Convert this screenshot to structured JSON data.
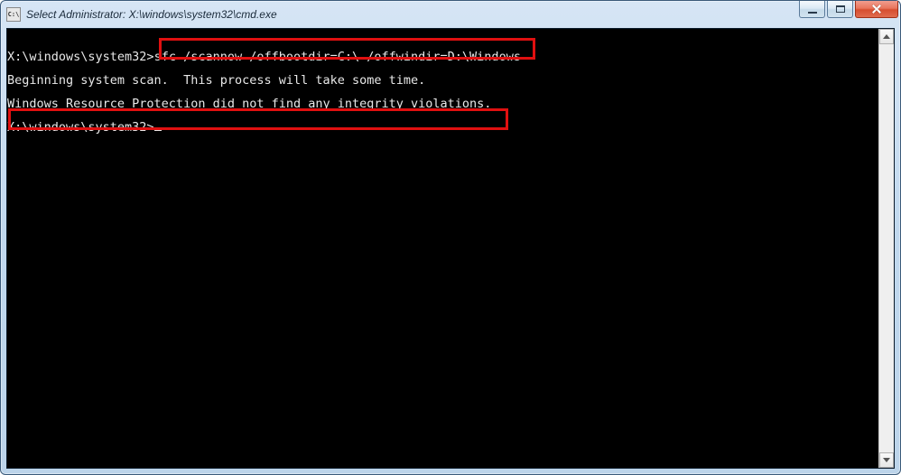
{
  "window": {
    "title": "Select Administrator: X:\\windows\\system32\\cmd.exe",
    "icon_label": "C:\\"
  },
  "terminal": {
    "prompt1": "X:\\windows\\system32>",
    "command1": "sfc /scannow /offbootdir=C:\\ /offwindir=D:\\Windows",
    "blank": "",
    "line2": "Beginning system scan.  This process will take some time.",
    "line3": "Windows Resource Protection did not find any integrity violations.",
    "prompt2": "X:\\windows\\system32>"
  }
}
